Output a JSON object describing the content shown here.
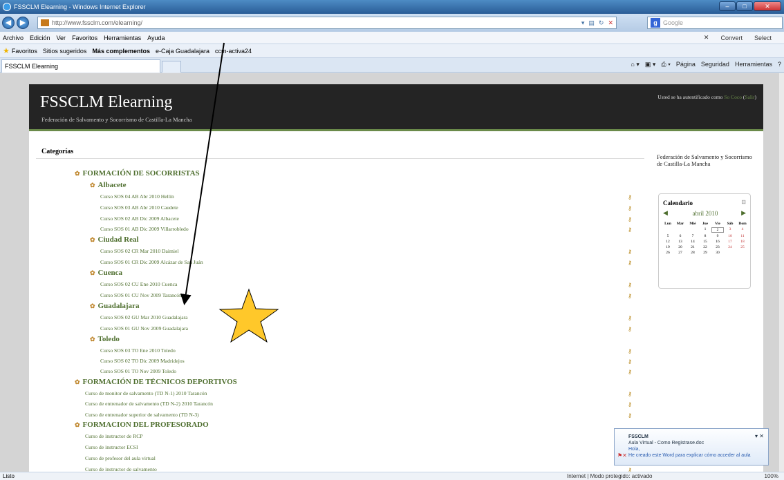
{
  "window": {
    "title": "FSSCLM Elearning - Windows Internet Explorer"
  },
  "address": {
    "url": "http://www.fssclm.com/elearning/"
  },
  "search": {
    "placeholder": "Google"
  },
  "menu": {
    "items": [
      "Archivo",
      "Edición",
      "Ver",
      "Favoritos",
      "Herramientas",
      "Ayuda"
    ],
    "convert": "Convert",
    "select": "Select"
  },
  "favorites": {
    "label": "Favoritos",
    "items": [
      "Sitios sugeridos",
      "Más complementos",
      "e-Caja Guadalajara",
      "ccm-activa24"
    ]
  },
  "tab": {
    "title": "FSSCLM Elearning"
  },
  "commands": {
    "pagina": "Página",
    "seguridad": "Seguridad",
    "herramientas": "Herramientas"
  },
  "site": {
    "title": "FSSCLM Elearning",
    "subtitle": "Federación de Salvamento y Socorrismo de Castilla-La Mancha",
    "login_prefix": "Usted se ha autentificado como",
    "user": "So Coco",
    "logout": "Salir"
  },
  "categories_heading": "Categorías",
  "cat": {
    "socorristas": "FORMACIÓN DE SOCORRISTAS",
    "albacete": "Albacete",
    "ciudad_real": "Ciudad Real",
    "cuenca": "Cuenca",
    "guadalajara": "Guadalajara",
    "toledo": "Toledo",
    "tecnicos": "FORMACIÓN DE TÉCNICOS DEPORTIVOS",
    "profesorado": "FORMACION DEL PROFESORADO"
  },
  "courses": {
    "albacete": [
      "Curso SOS 04 AB Abr 2010 Hellín",
      "Curso SOS 03 AB Abr 2010 Caudete",
      "Curso SOS 02 AB Dic 2009 Albacete",
      "Curso SOS 01 AB Dic 2009 Villarrobledo"
    ],
    "ciudad_real": [
      "Curso SOS 02 CR Mar 2010 Daimiel",
      "Curso SOS 01 CR Dic 2009 Alcázar de San Juán"
    ],
    "cuenca": [
      "Curso SOS 02 CU Ene 2010 Cuenca",
      "Curso SOS 01 CU Nov 2009 Tarancón"
    ],
    "guadalajara": [
      "Curso SOS 02 GU Mar 2010 Guadalajara",
      "Curso SOS 01 GU Nov 2009 Guadalajara"
    ],
    "toledo": [
      "Curso SOS 03 TO Ene 2010 Toledo",
      "Curso SOS 02 TO Dic 2009 Madridejos",
      "Curso SOS 01 TO Nov 2009 Toledo"
    ],
    "tecnicos": [
      "Curso de monitor de salvamento (TD N-1) 2010 Tarancón",
      "Curso de entrenador de salvamento (TD N-2) 2010 Tarancón",
      "Curso de entrenador superior de salvamento (TD N-3)"
    ],
    "profesorado": [
      "Curso de instructor de RCP",
      "Curso de instructor ECSI",
      "Curso de profesor del aula virtual",
      "Curso de instructor de salvamento"
    ]
  },
  "sidebar": {
    "org": "Federación de Salvamento y Socorrismo de Castilla-La Mancha"
  },
  "calendar": {
    "title": "Calendario",
    "month": "abril 2010",
    "days": [
      "Lun",
      "Mar",
      "Mié",
      "Jue",
      "Vie",
      "Sáb",
      "Dom"
    ],
    "weeks": [
      [
        "",
        "",
        "",
        "1",
        "2",
        "3",
        "4"
      ],
      [
        "5",
        "6",
        "7",
        "8",
        "9",
        "10",
        "11"
      ],
      [
        "12",
        "13",
        "14",
        "15",
        "16",
        "17",
        "18"
      ],
      [
        "19",
        "20",
        "21",
        "22",
        "23",
        "24",
        "25"
      ],
      [
        "26",
        "27",
        "28",
        "29",
        "30",
        "",
        ""
      ]
    ]
  },
  "notification": {
    "from": "FSSCLM",
    "attachment": "Aula Virtual - Como Registrase.doc",
    "greeting": "Hola,",
    "message": "He creado este Word para explicar cómo acceder al aula"
  },
  "status": {
    "left": "Listo",
    "zone": "Internet | Modo protegido: activado",
    "zoom": "100%"
  },
  "colors": {
    "link": "#4f6f2f",
    "header_bg": "#242424",
    "star": "#ffc82a",
    "arrow": "#000000"
  }
}
